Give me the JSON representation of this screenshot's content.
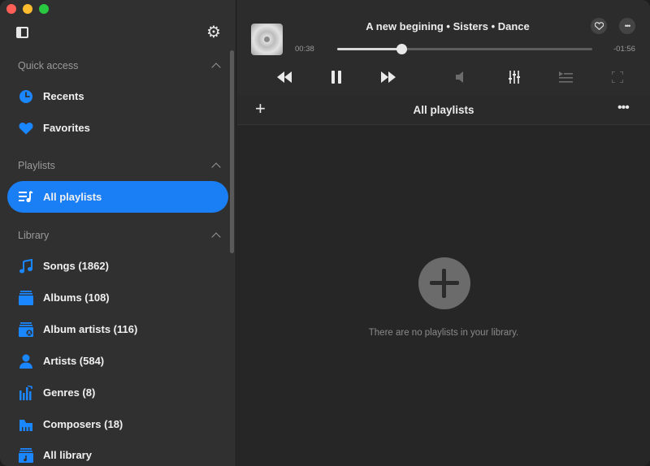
{
  "sidebar": {
    "sections": [
      {
        "title": "Quick access",
        "items": [
          {
            "label": "Recents",
            "icon": "clock-icon"
          },
          {
            "label": "Favorites",
            "icon": "heart-icon"
          }
        ]
      },
      {
        "title": "Playlists",
        "items": [
          {
            "label": "All playlists",
            "icon": "playlist-icon",
            "active": true
          }
        ]
      },
      {
        "title": "Library",
        "items": [
          {
            "label": "Songs (1862)",
            "icon": "music-note-icon"
          },
          {
            "label": "Albums (108)",
            "icon": "album-stack-icon"
          },
          {
            "label": "Album artists (116)",
            "icon": "album-artist-icon"
          },
          {
            "label": "Artists (584)",
            "icon": "person-icon"
          },
          {
            "label": "Genres (8)",
            "icon": "genres-icon"
          },
          {
            "label": "Composers (18)",
            "icon": "composer-piano-icon"
          },
          {
            "label": "All library",
            "icon": "library-icon"
          }
        ]
      }
    ]
  },
  "player": {
    "track": "A new begining • Sisters • Dance",
    "elapsed": "00:38",
    "remaining": "-01:56",
    "progress_fraction": 0.25
  },
  "toolbar": {
    "add_label": "+",
    "title": "All playlists",
    "more_label": "•••"
  },
  "empty_state": {
    "message": "There are no playlists in your library."
  },
  "colors": {
    "accent": "#1a7ff5",
    "icon_blue": "#1a86ff"
  }
}
